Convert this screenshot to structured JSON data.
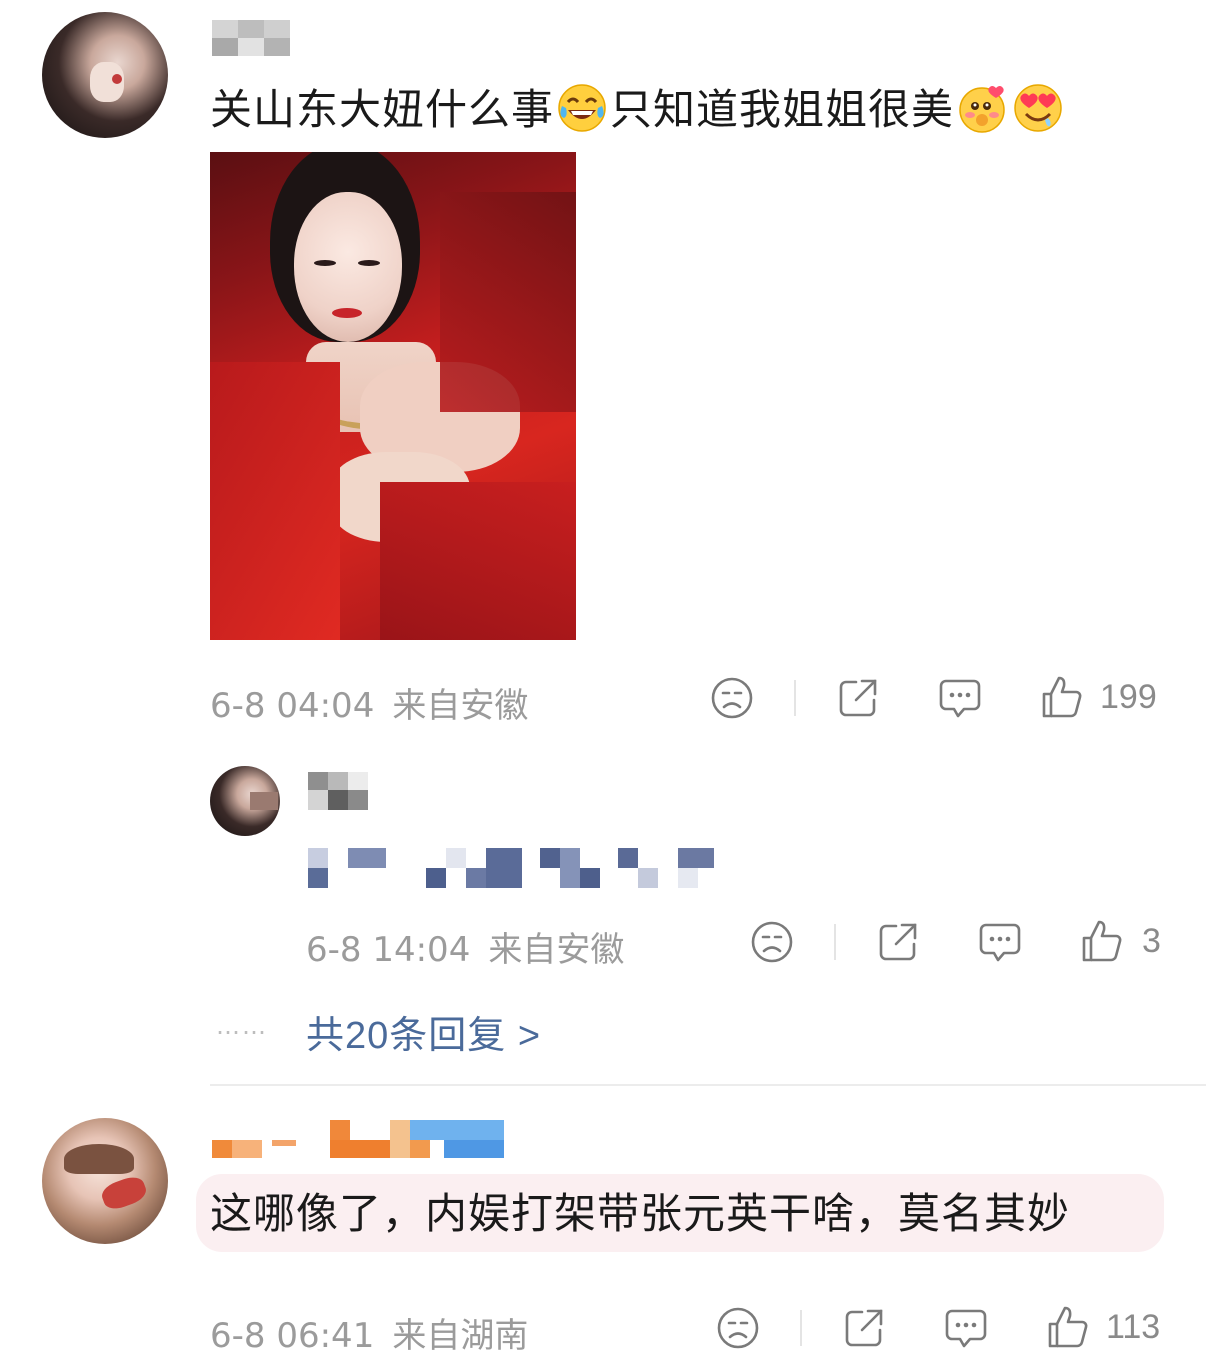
{
  "comments": [
    {
      "text_before": "关山东大妞什么事",
      "text_middle": "只知道我姐姐很美",
      "emojis": [
        "laugh-cry-emoji",
        "shy-love-emoji",
        "heart-eyes-emoji"
      ],
      "time": "6-8 04:04",
      "location": "来自安徽",
      "likes": "199"
    },
    {
      "time": "6-8 06:41",
      "location": "来自湖南",
      "text": "这哪像了，内娱打架带张元英干啥，莫名其妙",
      "likes": "113"
    }
  ],
  "reply": {
    "time": "6-8 14:04",
    "location": "来自安徽",
    "likes": "3"
  },
  "more_replies": "共20条回复 >",
  "more_dots": "……",
  "colors": {
    "link": "#4a6a9a",
    "meta": "#9b9b9b",
    "highlight_bg": "#fbeff1"
  }
}
